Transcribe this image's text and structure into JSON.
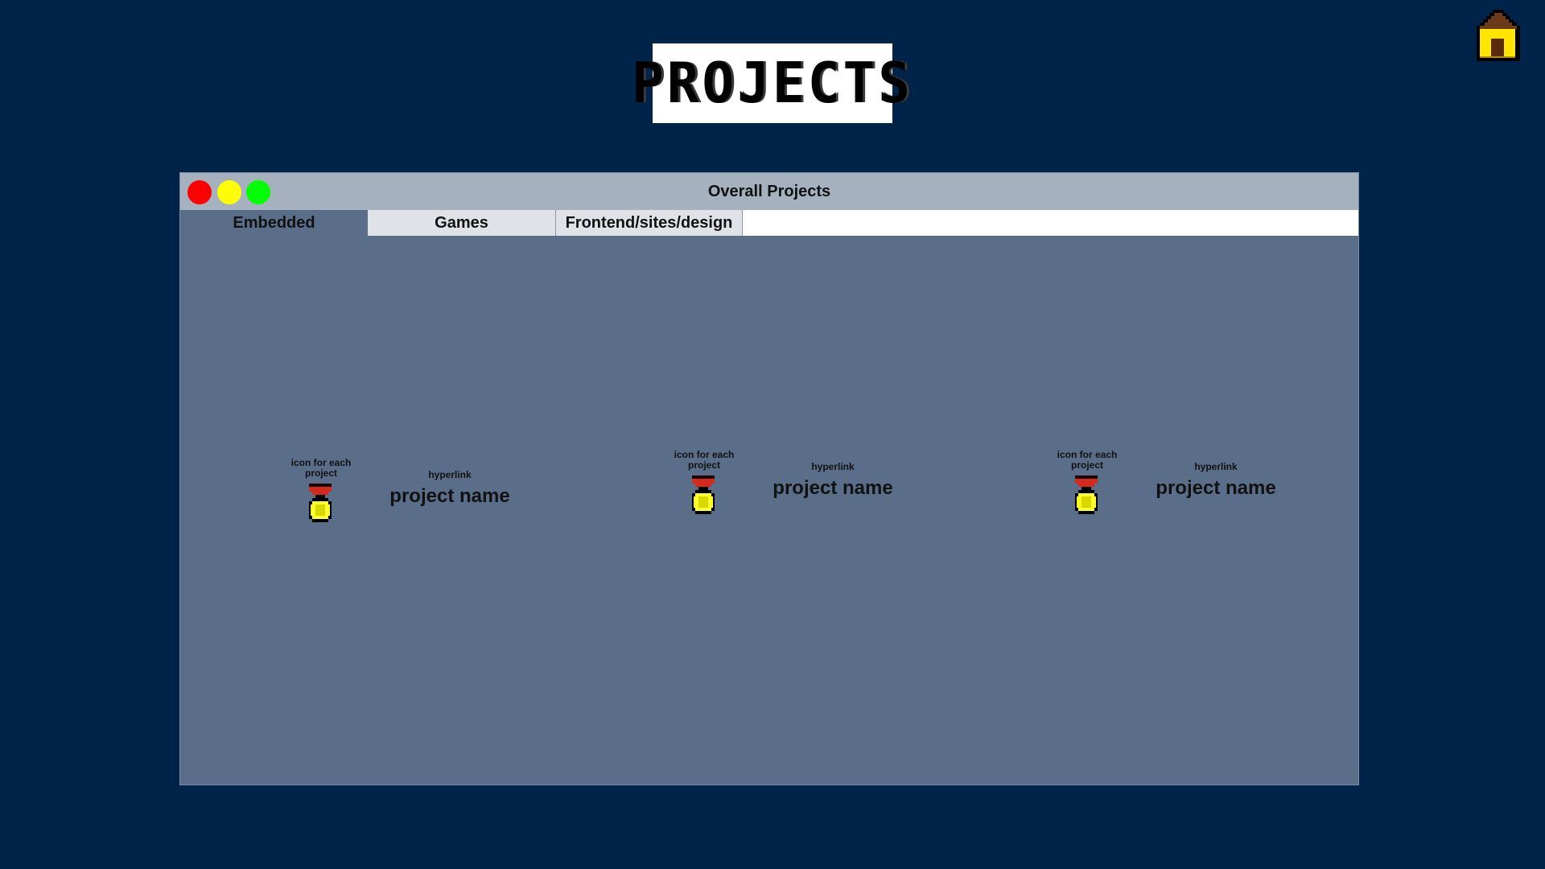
{
  "page": {
    "title": "PROJECTS",
    "home_icon": "home-icon"
  },
  "window": {
    "title": "Overall Projects",
    "controls": [
      {
        "name": "close",
        "color": "#ff0000"
      },
      {
        "name": "minimize",
        "color": "#ffff00"
      },
      {
        "name": "maximize",
        "color": "#00ff00"
      }
    ],
    "tabs": [
      {
        "label": "Embedded",
        "active": true
      },
      {
        "label": "Games",
        "active": false
      },
      {
        "label": "Frontend/sites/design",
        "active": false
      }
    ]
  },
  "projects": [
    {
      "icon_caption": "icon for each project",
      "icon": "medal-icon",
      "link_label": "hyperlink",
      "name": "project name"
    },
    {
      "icon_caption": "icon for each project",
      "icon": "medal-icon",
      "link_label": "hyperlink",
      "name": "project name"
    },
    {
      "icon_caption": "icon for each project",
      "icon": "medal-icon",
      "link_label": "hyperlink",
      "name": "project name"
    }
  ],
  "colors": {
    "background": "#00234a",
    "window_body": "#5b6e89",
    "titlebar": "#a6b1c0",
    "medal_gold": "#ffff2a",
    "ribbon_red": "#d42a1e",
    "house_roof": "#6b3a16",
    "house_wall": "#ffe500"
  }
}
